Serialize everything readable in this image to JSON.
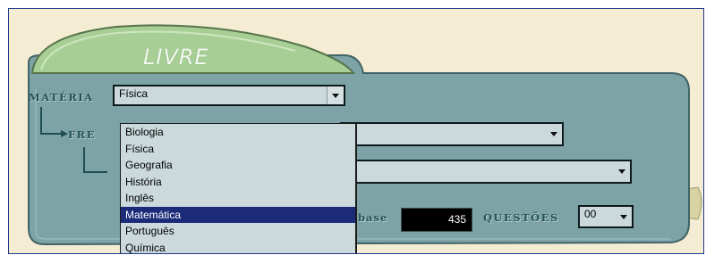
{
  "tab": {
    "title": "LIVRE"
  },
  "materia": {
    "label": "MATÉRIA",
    "selected": "Física",
    "options": [
      "Biologia",
      "Física",
      "Geografia",
      "História",
      "Inglês",
      "Matemática",
      "Português",
      "Química"
    ],
    "highlighted": "Matemática"
  },
  "frente": {
    "label_visible": "FRE",
    "selected": ""
  },
  "topico": {
    "selected": ""
  },
  "base": {
    "label_visible": "base",
    "value": "435"
  },
  "questoes": {
    "label": "QUESTÕES",
    "selected": "00"
  },
  "colors": {
    "panel": "#7ea3a6",
    "tab": "#a7cf95",
    "highlight": "#1c2a7a",
    "background": "#f5edd3"
  }
}
